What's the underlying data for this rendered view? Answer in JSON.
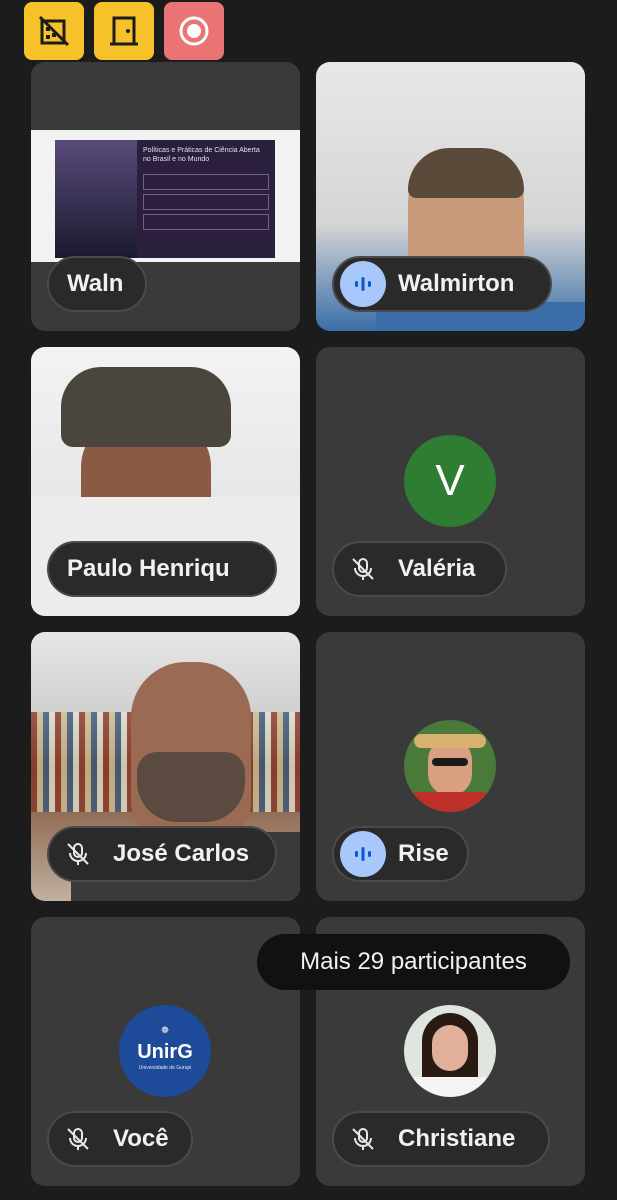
{
  "toolbar": {
    "buttons": [
      {
        "icon": "camera-off-icon",
        "color": "#f7c12a"
      },
      {
        "icon": "door-exit-icon",
        "color": "#f7c12a"
      },
      {
        "icon": "record-icon",
        "color": "#ea7373"
      }
    ]
  },
  "tiles": [
    {
      "name": "Waln",
      "mic": "none",
      "type": "screenshare"
    },
    {
      "name": "Walmirton",
      "mic": "speaking",
      "type": "video"
    },
    {
      "name": "Paulo Henriqu",
      "mic": "none",
      "type": "video"
    },
    {
      "name": "Valéria",
      "mic": "muted",
      "type": "avatar",
      "avatar_letter": "V"
    },
    {
      "name": "José Carlos",
      "mic": "muted",
      "type": "video"
    },
    {
      "name": "Rise",
      "mic": "speaking",
      "type": "avatar-photo"
    },
    {
      "name": "Você",
      "mic": "muted",
      "type": "logo",
      "logo_text": "UnirG",
      "logo_subtext": "Universidade de Gurupi"
    },
    {
      "name": "Christiane",
      "mic": "muted",
      "type": "avatar-photo"
    }
  ],
  "screenshare": {
    "slide_title": "Políticas e Práticas de Ciência Aberta no Brasil e no Mundo"
  },
  "tooltip": {
    "text": "Mais 29 participantes"
  },
  "colors": {
    "accent_yellow": "#f7c12a",
    "record_red": "#ea7373",
    "speaking_blue": "#a8c7fa",
    "avatar_green": "#2e7d32"
  }
}
